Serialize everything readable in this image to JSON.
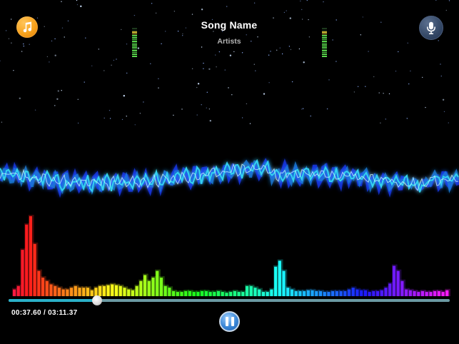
{
  "header": {
    "song_name": "Song Name",
    "artist": "Artists"
  },
  "player": {
    "time_readout": "00:37.60 / 03:11.37",
    "elapsed": "00:37.60",
    "duration": "03:11.37",
    "progress_fraction": 0.2,
    "state": "playing"
  },
  "icons": {
    "left_button": "music-note-icon",
    "right_button": "microphone-icon",
    "center_button": "pause-icon"
  },
  "colors": {
    "accent_orange": "#f7a11c",
    "mic_button": "#344866",
    "progress_fill": "#2bb0c8",
    "progress_track": "#6b9aa3",
    "wave_cyan": "#35d8f0",
    "wave_blue": "#1a3cff"
  },
  "vu_meters": {
    "left_level": 0.9,
    "right_level": 0.9
  },
  "spectrum": {
    "levels": [
      0.08,
      0.12,
      0.55,
      0.85,
      0.95,
      0.62,
      0.3,
      0.22,
      0.18,
      0.14,
      0.12,
      0.1,
      0.08,
      0.08,
      0.1,
      0.12,
      0.1,
      0.1,
      0.1,
      0.07,
      0.1,
      0.12,
      0.12,
      0.13,
      0.14,
      0.13,
      0.12,
      0.1,
      0.08,
      0.07,
      0.12,
      0.18,
      0.25,
      0.18,
      0.22,
      0.3,
      0.22,
      0.12,
      0.1,
      0.06,
      0.05,
      0.05,
      0.06,
      0.06,
      0.05,
      0.05,
      0.06,
      0.06,
      0.05,
      0.05,
      0.06,
      0.05,
      0.04,
      0.05,
      0.06,
      0.05,
      0.05,
      0.12,
      0.12,
      0.1,
      0.08,
      0.05,
      0.05,
      0.08,
      0.35,
      0.42,
      0.3,
      0.1,
      0.08,
      0.06,
      0.06,
      0.06,
      0.07,
      0.07,
      0.06,
      0.06,
      0.05,
      0.05,
      0.06,
      0.06,
      0.06,
      0.06,
      0.08,
      0.1,
      0.08,
      0.07,
      0.07,
      0.05,
      0.06,
      0.06,
      0.07,
      0.1,
      0.15,
      0.36,
      0.3,
      0.18,
      0.08,
      0.07,
      0.06,
      0.05,
      0.06,
      0.05,
      0.05,
      0.06,
      0.06,
      0.05,
      0.07
    ]
  }
}
